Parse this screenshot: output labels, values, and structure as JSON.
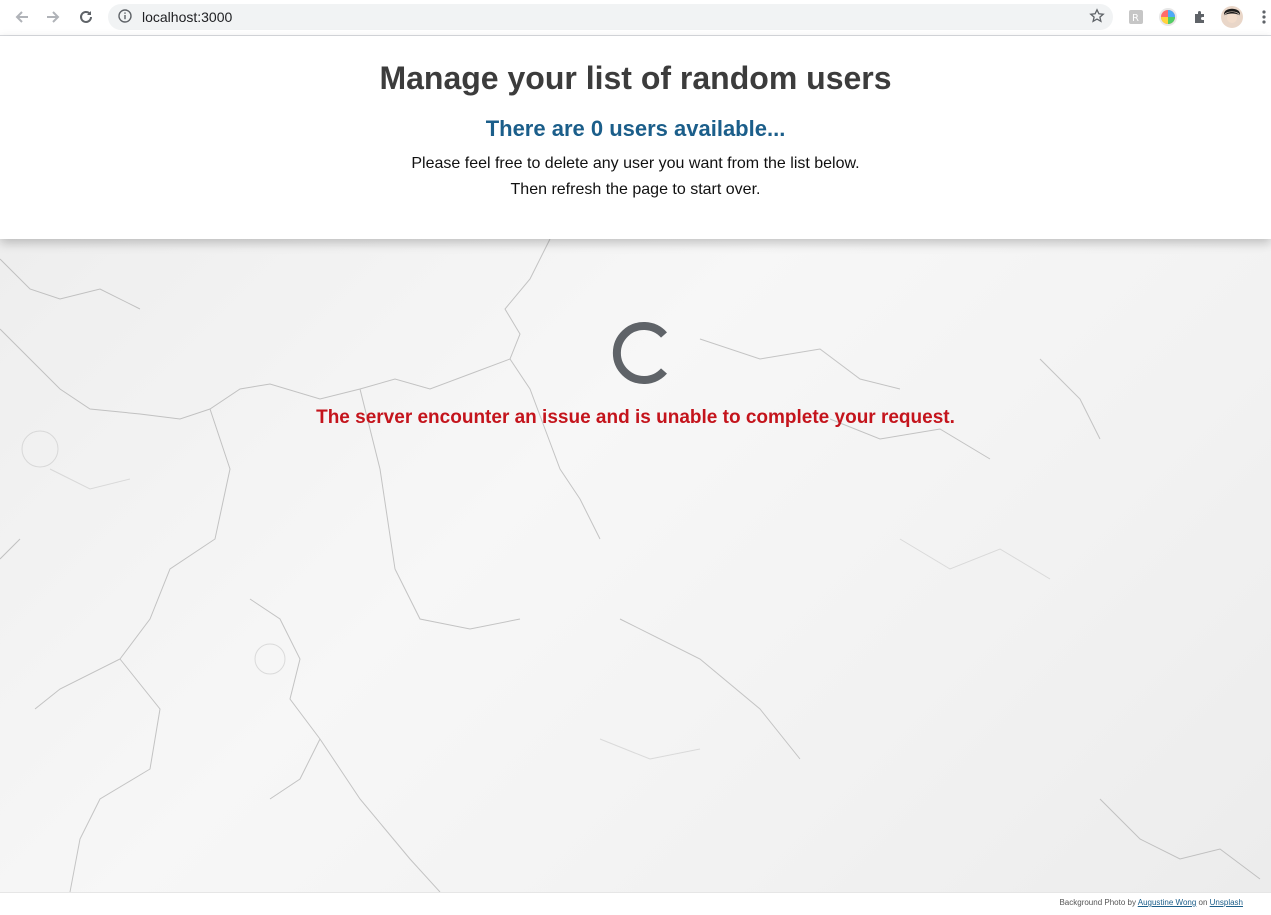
{
  "browser": {
    "url": "localhost:3000",
    "icons": [
      "back-icon",
      "forward-icon",
      "reload-icon",
      "info-icon",
      "bookmark-star-icon",
      "extension-icon",
      "profile-avatar",
      "more-menu-icon"
    ]
  },
  "header": {
    "title": "Manage your list of random users",
    "subtitle": "There are 0 users available...",
    "line1": "Please feel free to delete any user you want from the list below.",
    "line2": "Then refresh the page to start over."
  },
  "main": {
    "error_message": "The server encounter an issue and is unable to complete your request.",
    "error_color": "#c4141c",
    "spinner_color": "#5f6368"
  },
  "footer": {
    "prefix": "Background Photo by ",
    "author": "Augustine Wong",
    "middle": " on ",
    "source": "Unsplash"
  },
  "colors": {
    "title": "#3c3c3c",
    "subtitle": "#1b5e8a"
  }
}
